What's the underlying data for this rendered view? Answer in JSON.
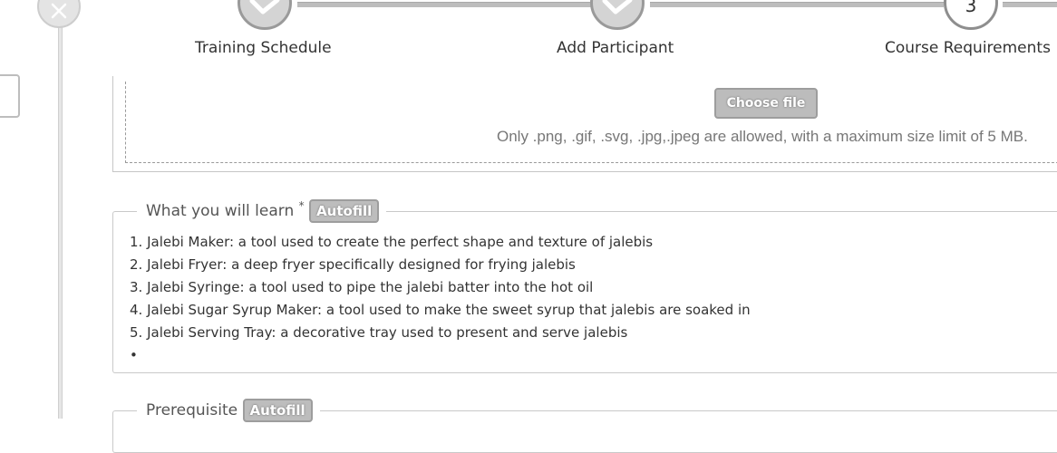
{
  "steps": [
    {
      "label": "Training Schedule",
      "state": "completed"
    },
    {
      "label": "Add Participant",
      "state": "completed"
    },
    {
      "label": "Course Requirements",
      "number": "3",
      "state": "active"
    }
  ],
  "upload": {
    "button_label": "Choose file",
    "hint": "Only .png, .gif, .svg, .jpg,.jpeg are allowed, with a maximum size limit of 5 MB."
  },
  "learn": {
    "legend": "What you will learn",
    "required_mark": "*",
    "autofill_label": "Autofill",
    "lines": [
      "1. Jalebi Maker: a tool used to create the perfect shape and texture of jalebis",
      "2. Jalebi Fryer: a deep fryer specifically designed for frying jalebis",
      "3. Jalebi Syringe: a tool used to pipe the jalebi batter into the hot oil",
      "4. Jalebi Sugar Syrup Maker: a tool used to make the sweet syrup that jalebis are soaked in",
      "5. Jalebi Serving Tray: a decorative tray used to present and serve jalebis",
      "•"
    ]
  },
  "prerequisite": {
    "legend": "Prerequisite",
    "autofill_label": "Autofill"
  },
  "icons": {
    "close": "close-icon",
    "completed_step": "check-icon"
  }
}
